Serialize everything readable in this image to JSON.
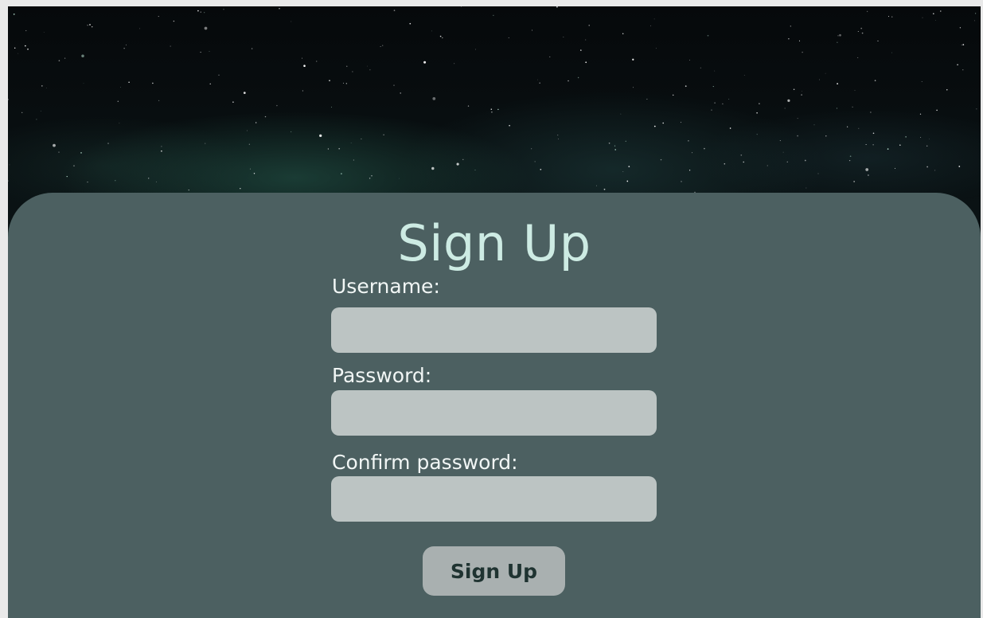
{
  "title": "Sign Up",
  "fields": [
    {
      "label": "Username:",
      "value": "",
      "placeholder": ""
    },
    {
      "label": "Password:",
      "value": "",
      "placeholder": ""
    },
    {
      "label": "Confirm password:",
      "value": "",
      "placeholder": ""
    }
  ],
  "submit_label": "Sign Up",
  "colors": {
    "card": "#4c6061",
    "title": "#cdebe3",
    "input": "#bcc4c3",
    "button": "#a9b0b0"
  }
}
